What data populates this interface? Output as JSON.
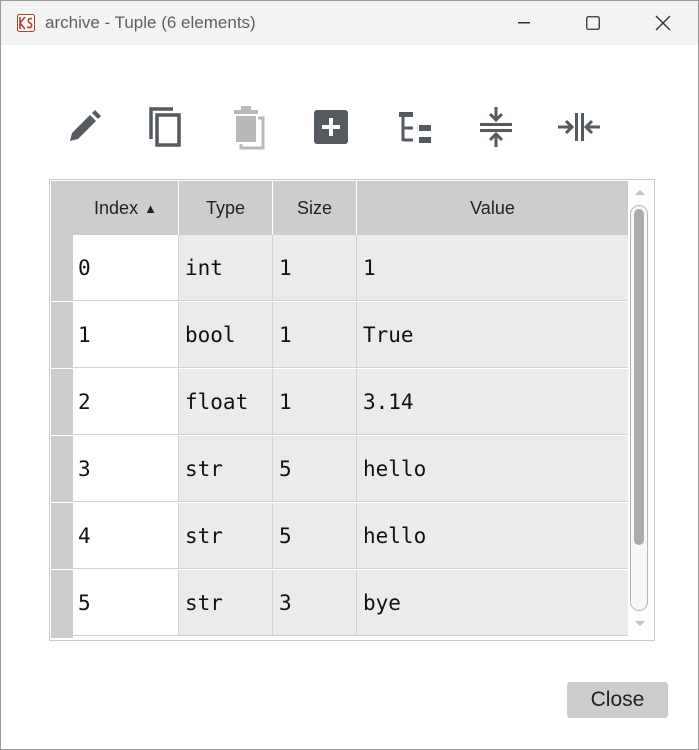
{
  "window": {
    "title": "archive - Tuple (6 elements)",
    "icon": "app-logo-icon",
    "controls": [
      "minimize-icon",
      "maximize-icon",
      "close-icon"
    ]
  },
  "toolbar": {
    "buttons": [
      {
        "icon": "edit-pencil-icon"
      },
      {
        "icon": "copy-icon"
      },
      {
        "icon": "delete-trash-icon"
      },
      {
        "icon": "insert-plus-icon"
      },
      {
        "icon": "tree-view-icon"
      },
      {
        "icon": "collapse-vertical-icon"
      },
      {
        "icon": "collapse-horizontal-icon"
      }
    ],
    "icon_color": "#555a60",
    "disabled_color": "#b7b8ba"
  },
  "table": {
    "headers": {
      "index": "Index",
      "type": "Type",
      "size": "Size",
      "value": "Value"
    },
    "sort_indicator": "▲",
    "rows": [
      {
        "index": "0",
        "type": "int",
        "size": "1",
        "value": "1"
      },
      {
        "index": "1",
        "type": "bool",
        "size": "1",
        "value": "True"
      },
      {
        "index": "2",
        "type": "float",
        "size": "1",
        "value": "3.14"
      },
      {
        "index": "3",
        "type": "str",
        "size": "5",
        "value": "hello"
      },
      {
        "index": "4",
        "type": "str",
        "size": "5",
        "value": "hello"
      },
      {
        "index": "5",
        "type": "str",
        "size": "3",
        "value": "bye"
      }
    ]
  },
  "footer": {
    "close_label": "Close"
  }
}
